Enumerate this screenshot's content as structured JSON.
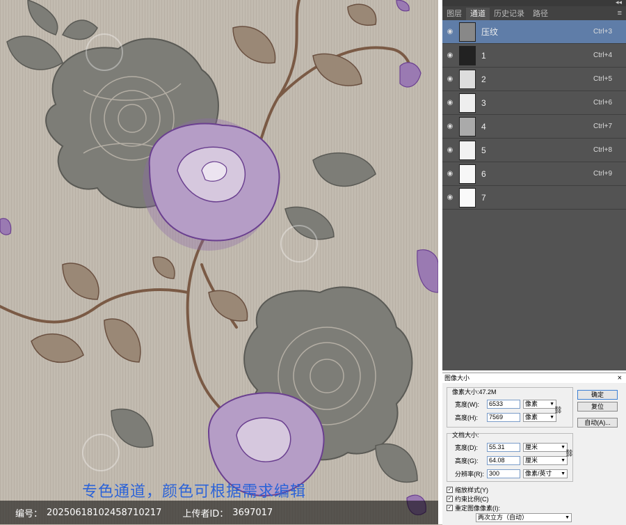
{
  "artwork": {
    "caption": "专色通道，颜色可根据需求编辑",
    "footer": {
      "id_label": "编号：",
      "id_value": "20250618102458710217",
      "uploader_label": "上传者ID：",
      "uploader_value": "3697017"
    }
  },
  "channels_panel": {
    "tabs": [
      "图层",
      "通道",
      "历史记录",
      "路径"
    ],
    "active_tab": "通道",
    "channels": [
      {
        "name": "压纹",
        "shortcut": "Ctrl+3",
        "active": true
      },
      {
        "name": "1",
        "shortcut": "Ctrl+4",
        "active": false
      },
      {
        "name": "2",
        "shortcut": "Ctrl+5",
        "active": false
      },
      {
        "name": "3",
        "shortcut": "Ctrl+6",
        "active": false
      },
      {
        "name": "4",
        "shortcut": "Ctrl+7",
        "active": false
      },
      {
        "name": "5",
        "shortcut": "Ctrl+8",
        "active": false
      },
      {
        "name": "6",
        "shortcut": "Ctrl+9",
        "active": false
      },
      {
        "name": "7",
        "shortcut": "",
        "active": false
      }
    ]
  },
  "image_size_dialog": {
    "title": "图像大小",
    "pixel_dimensions_label": "像素大小:47.2M",
    "width_label": "宽度(W):",
    "width_value": "6533",
    "width_unit": "像素",
    "height_label": "高度(H):",
    "height_value": "7569",
    "height_unit": "像素",
    "document_size_label": "文档大小:",
    "doc_width_label": "宽度(D):",
    "doc_width_value": "55.31",
    "doc_width_unit": "厘米",
    "doc_height_label": "高度(G):",
    "doc_height_value": "64.08",
    "doc_height_unit": "厘米",
    "resolution_label": "分辨率(R):",
    "resolution_value": "300",
    "resolution_unit": "像素/英寸",
    "ok_button": "确定",
    "reset_button": "复位",
    "auto_button": "自动(A)...",
    "scale_styles": "缩放样式(Y)",
    "constrain_proportions": "约束比例(C)",
    "resample": "重定图像像素(I):",
    "resample_method": "两次立方（自动）"
  }
}
